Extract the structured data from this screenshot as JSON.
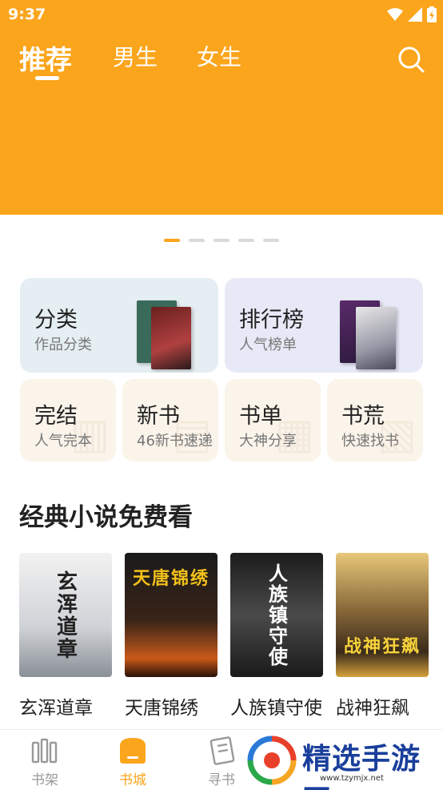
{
  "status_bar": {
    "time": "9:37"
  },
  "header": {
    "tabs": [
      {
        "label": "推荐",
        "active": true
      },
      {
        "label": "男生",
        "active": false
      },
      {
        "label": "女生",
        "active": false
      }
    ],
    "background_color": "#fba51c"
  },
  "banner": {
    "dot_count": 5,
    "active_dot": 0
  },
  "categories": {
    "big": [
      {
        "title": "分类",
        "sub": "作品分类",
        "bg": "#e5eef2"
      },
      {
        "title": "排行榜",
        "sub": "人气榜单",
        "bg": "#e8e9f7"
      }
    ],
    "small": [
      {
        "title": "完结",
        "sub": "人气完本"
      },
      {
        "title": "新书",
        "sub": "46新书速递"
      },
      {
        "title": "书单",
        "sub": "大神分享"
      },
      {
        "title": "书荒",
        "sub": "快速找书"
      }
    ]
  },
  "section": {
    "title": "经典小说免费看"
  },
  "books": [
    {
      "title": "玄浑道章",
      "cover_text": "玄浑道章"
    },
    {
      "title": "天唐锦绣",
      "cover_text": "天唐锦绣"
    },
    {
      "title": "人族镇守使",
      "cover_text": "人族镇守使"
    },
    {
      "title": "战神狂飙",
      "cover_text": "战神狂飙"
    }
  ],
  "bottom_nav": [
    {
      "label": "书架",
      "icon": "bookshelf-icon",
      "active": false
    },
    {
      "label": "书城",
      "icon": "bookstore-icon",
      "active": true
    },
    {
      "label": "寻书",
      "icon": "find-book-icon",
      "active": false
    }
  ],
  "watermark": {
    "text": "精选手游网",
    "url": "www.tzymjx.net"
  },
  "accent_color": "#fba51c"
}
